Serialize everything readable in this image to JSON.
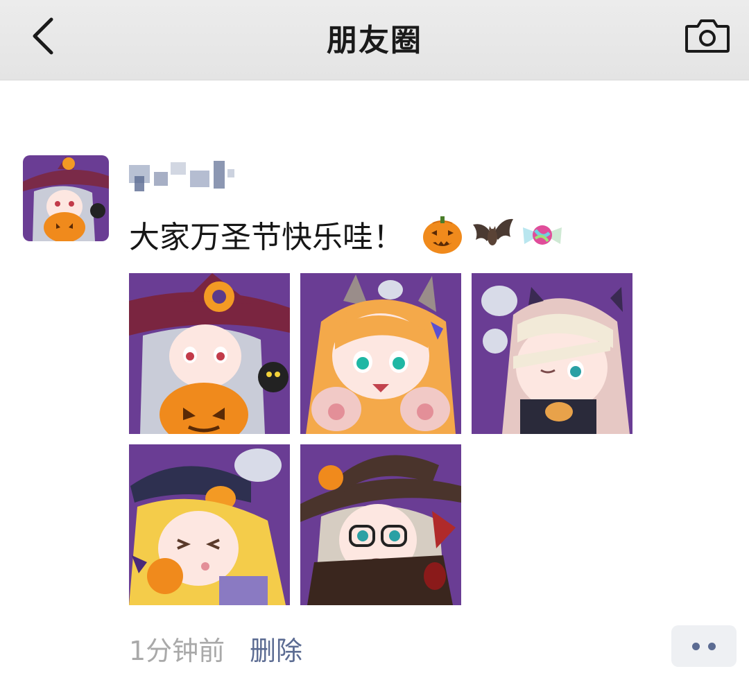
{
  "header": {
    "title": "朋友圈",
    "back_icon": "chevron-left-icon",
    "camera_icon": "camera-icon"
  },
  "post": {
    "author_name": "",
    "text": "大家万圣节快乐哇！",
    "emojis": [
      "jack-o-lantern-icon",
      "bat-icon",
      "candy-icon"
    ],
    "photo_count": 5,
    "photos": [
      {
        "name": "photo-witch-pumpkin",
        "theme": "witch with pumpkin"
      },
      {
        "name": "photo-cat-paws",
        "theme": "cat ears girl with paws"
      },
      {
        "name": "photo-mummy",
        "theme": "mummy wrapped girl"
      },
      {
        "name": "photo-blonde-witch",
        "theme": "blonde girl in navy hat"
      },
      {
        "name": "photo-glasses-witch",
        "theme": "witch with glasses"
      }
    ],
    "timestamp": "1分钟前",
    "delete_label": "删除",
    "more_icon": "more-dots-icon"
  },
  "colors": {
    "link": "#5b6b92",
    "muted": "#a9a9a9",
    "header_bg": "#e8e8e8",
    "photo_bg": "#6a3d94",
    "pumpkin": "#f08a1c"
  }
}
